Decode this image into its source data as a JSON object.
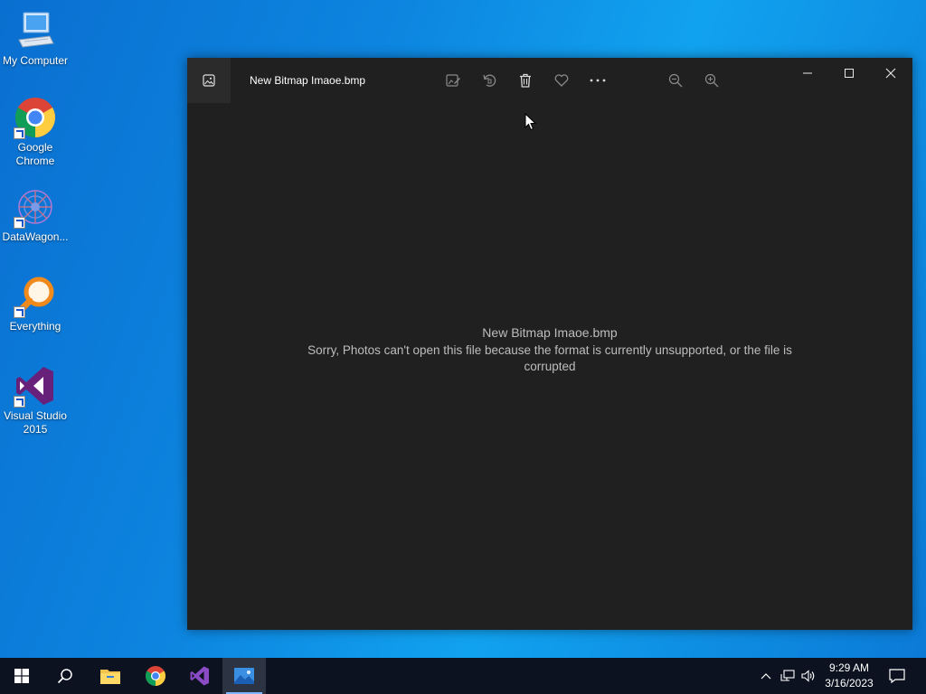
{
  "desktop": {
    "icons": [
      {
        "label": "My Computer"
      },
      {
        "label": "Google Chrome"
      },
      {
        "label": "DataWagon..."
      },
      {
        "label": "Everything"
      },
      {
        "label": "Visual Studio 2015"
      }
    ]
  },
  "window": {
    "file_title": "New Bitmap Imaoe.bmp",
    "toolbar": [
      "edit-icon",
      "rotate-icon",
      "delete-icon",
      "favorite-icon",
      "more-icon",
      "zoom-out-icon",
      "zoom-in-icon"
    ],
    "message_title": "New Bitmap Imaoe.bmp",
    "message_line1": "Sorry, Photos can't open this file because the format is currently unsupported, or the file is",
    "message_line2": "corrupted"
  },
  "taskbar": {
    "time": "9:29 AM",
    "date": "3/16/2023"
  },
  "colors": {
    "window_bg": "#202020",
    "taskbar_bg": "#0c1220",
    "accent": "#0d86e0"
  }
}
